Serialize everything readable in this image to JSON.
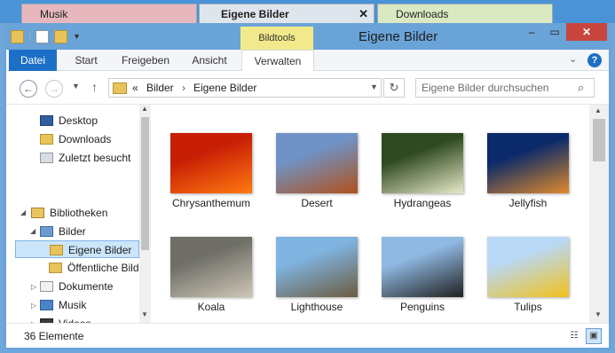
{
  "outer_tabs": [
    {
      "label": "Musik",
      "color": "#e6b8be"
    },
    {
      "label": "Eigene Bilder",
      "color": "#dfe5ec",
      "close": "✕"
    },
    {
      "label": "Downloads",
      "color": "#dbe9c2"
    }
  ],
  "window": {
    "title": "Eigene Bilder",
    "context_tab": "Bildtools",
    "buttons": {
      "minimize": "–",
      "maximize": "▭",
      "close": "✕"
    }
  },
  "ribbon": {
    "tabs": [
      "Datei",
      "Start",
      "Freigeben",
      "Ansicht",
      "Verwalten"
    ],
    "collapse": "⌄",
    "help": "?"
  },
  "nav": {
    "back": "←",
    "forward": "→",
    "recent": "▼",
    "up": "↑",
    "address": {
      "prefix": "«",
      "crumbs": [
        "Bilder",
        "Eigene Bilder"
      ],
      "separator": "›"
    },
    "refresh": "↻",
    "search_placeholder": "Eigene Bilder durchsuchen",
    "search_icon": "⌕"
  },
  "tree": {
    "favorites": [
      {
        "label": "Desktop",
        "icon": "desktop-icon"
      },
      {
        "label": "Downloads",
        "icon": "folder-icon"
      },
      {
        "label": "Zuletzt besucht",
        "icon": "recent-places-icon"
      }
    ],
    "libraries_label": "Bibliotheken",
    "pictures_label": "Bilder",
    "pictures_children": [
      "Eigene Bilder",
      "Öffentliche Bilder"
    ],
    "other_libraries": [
      {
        "label": "Dokumente",
        "icon": "documents-icon"
      },
      {
        "label": "Musik",
        "icon": "music-icon"
      },
      {
        "label": "Videos",
        "icon": "videos-icon"
      }
    ]
  },
  "files": [
    {
      "name": "Chrysanthemum",
      "colors": [
        "#c81e05",
        "#ff7a10"
      ]
    },
    {
      "name": "Desert",
      "colors": [
        "#6f93c6",
        "#b0501c"
      ]
    },
    {
      "name": "Hydrangeas",
      "colors": [
        "#2f4a20",
        "#e8eac9"
      ]
    },
    {
      "name": "Jellyfish",
      "colors": [
        "#0a2a6b",
        "#e08a2a"
      ]
    },
    {
      "name": "Koala",
      "colors": [
        "#6f6f68",
        "#cfc6b6"
      ]
    },
    {
      "name": "Lighthouse",
      "colors": [
        "#7fb3e0",
        "#6b5b3e"
      ]
    },
    {
      "name": "Penguins",
      "colors": [
        "#8fb9e2",
        "#202020"
      ]
    },
    {
      "name": "Tulips",
      "colors": [
        "#b9d8f5",
        "#f2c21a"
      ]
    }
  ],
  "status": {
    "count": "36 Elemente",
    "details_view": "☷",
    "large_icons_view": "▣"
  }
}
